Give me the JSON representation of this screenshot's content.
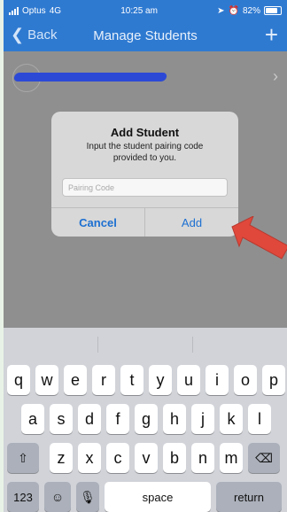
{
  "status_bar": {
    "carrier": "Optus",
    "network": "4G",
    "time": "10:25 am",
    "battery": "82%"
  },
  "nav": {
    "back_label": "Back",
    "title": "Manage Students",
    "add_icon": "plus-icon"
  },
  "dialog": {
    "title": "Add Student",
    "message": "Input the student pairing code provided to you.",
    "input_placeholder": "Pairing Code",
    "input_value": "",
    "cancel_label": "Cancel",
    "add_label": "Add"
  },
  "keyboard": {
    "row1": [
      "q",
      "w",
      "e",
      "r",
      "t",
      "y",
      "u",
      "i",
      "o",
      "p"
    ],
    "row2": [
      "a",
      "s",
      "d",
      "f",
      "g",
      "h",
      "j",
      "k",
      "l"
    ],
    "row3": [
      "z",
      "x",
      "c",
      "v",
      "b",
      "n",
      "m"
    ],
    "numbers_label": "123",
    "space_label": "space",
    "return_label": "return"
  },
  "colors": {
    "nav_bar": "#2f7ad1",
    "link": "#1c6fd1",
    "arrow": "#e0483b"
  }
}
